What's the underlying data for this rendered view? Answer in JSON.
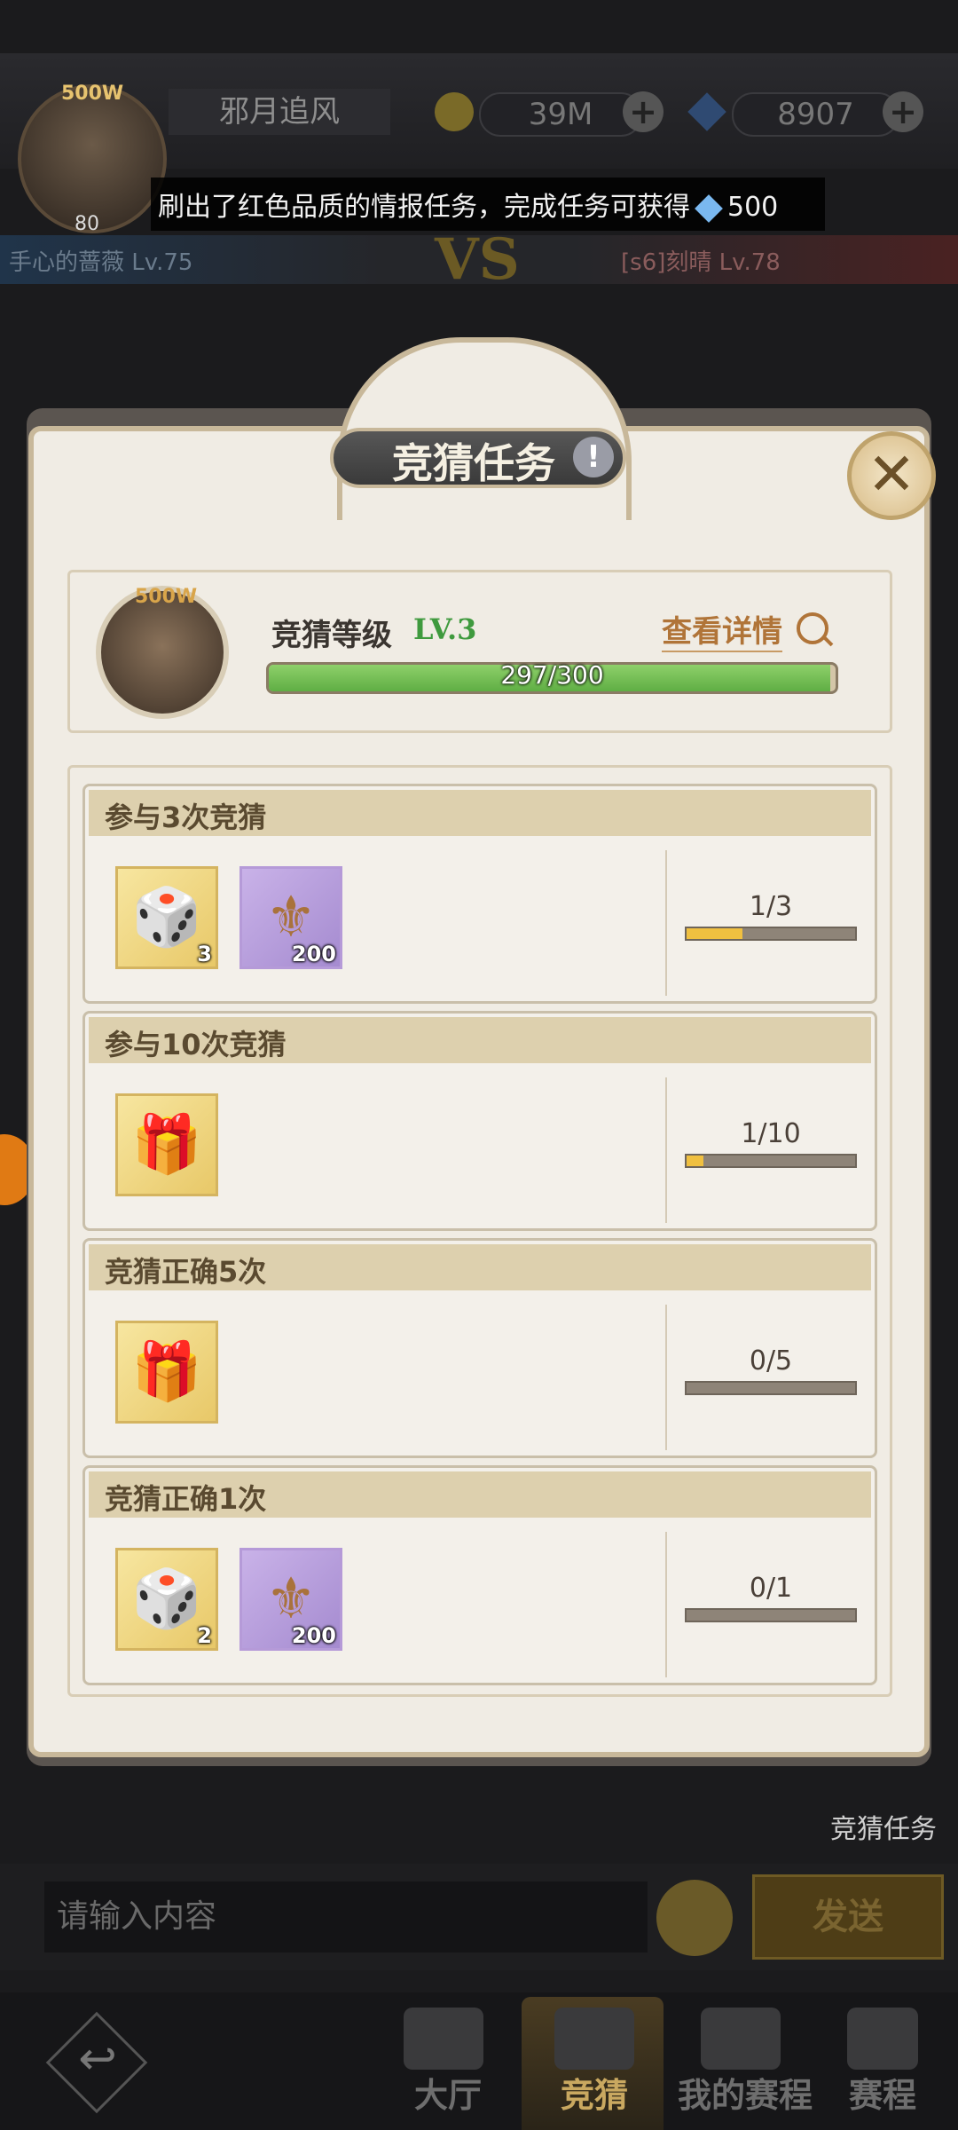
{
  "top": {
    "player_name": "邪月追风",
    "avatar_tag": "500W",
    "avatar_level": "80",
    "gold": "39M",
    "diamonds": "8907",
    "notice_text": "刷出了红色品质的情报任务，完成任务可获得",
    "notice_reward": "500",
    "player_left": "手心的蔷薇 Lv.75",
    "player_right": "[s6]刻晴 Lv.78",
    "vs": "VS"
  },
  "dialog": {
    "title": "竞猜任务",
    "info_icon": "!",
    "close_icon": "✕",
    "level": {
      "avatar_tag": "500W",
      "label": "竞猜等级",
      "value": "LV.3",
      "detail_link": "查看详情",
      "exp_text": "297/300",
      "exp_fraction": 0.99
    },
    "tasks": [
      {
        "title": "参与3次竞猜",
        "rewards": [
          {
            "kind": "dice-token-icon",
            "glyph": "🎲",
            "count": "3",
            "style": "gold"
          },
          {
            "kind": "medal-icon",
            "glyph": "⚜",
            "count": "200",
            "style": "purple"
          }
        ],
        "progress_text": "1/3",
        "progress_fraction": 0.333
      },
      {
        "title": "参与10次竞猜",
        "rewards": [
          {
            "kind": "gift-box-icon",
            "glyph": "🎁",
            "count": "",
            "style": "gold"
          }
        ],
        "progress_text": "1/10",
        "progress_fraction": 0.1
      },
      {
        "title": "竞猜正确5次",
        "rewards": [
          {
            "kind": "gift-box-icon",
            "glyph": "🎁",
            "count": "",
            "style": "gold"
          }
        ],
        "progress_text": "0/5",
        "progress_fraction": 0
      },
      {
        "title": "竞猜正确1次",
        "rewards": [
          {
            "kind": "dice-token-icon",
            "glyph": "🎲",
            "count": "2",
            "style": "gold"
          },
          {
            "kind": "medal-icon",
            "glyph": "⚜",
            "count": "200",
            "style": "purple"
          }
        ],
        "progress_text": "0/1",
        "progress_fraction": 0
      }
    ]
  },
  "side_label": "竞猜任务",
  "chat": {
    "placeholder": "请输入内容",
    "send_label": "发送"
  },
  "nav": {
    "back_glyph": "↩",
    "items": [
      "大厅",
      "竞猜",
      "我的赛程",
      "赛程"
    ],
    "active": "竞猜"
  },
  "colors": {
    "progress_fill": "#f0c040",
    "exp_fill": "#6fbe50",
    "accent_gold": "#b07438"
  }
}
